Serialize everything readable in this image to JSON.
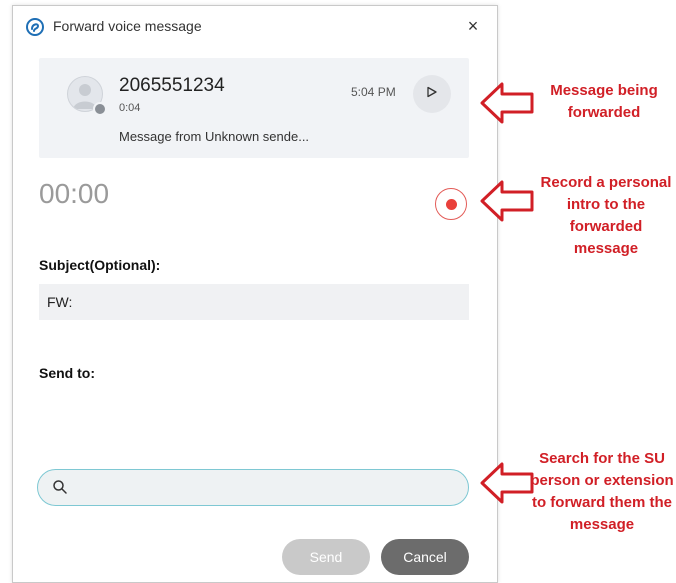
{
  "dialog": {
    "title": "Forward voice message",
    "close_glyph": "×"
  },
  "message": {
    "caller": "2065551234",
    "duration": "0:04",
    "preview": "Message from Unknown sende...",
    "time": "5:04 PM"
  },
  "recorder": {
    "elapsed": "00:00"
  },
  "subject": {
    "label": "Subject(Optional):",
    "value": "FW:"
  },
  "send_to": {
    "label": "Send to:",
    "search_value": "",
    "search_placeholder": ""
  },
  "actions": {
    "send_label": "Send",
    "cancel_label": "Cancel"
  },
  "annotations": {
    "forwarded": "Message being forwarded",
    "record": "Record a personal intro to the forwarded message",
    "search": "Search for the SU person or extension to forward them the message"
  },
  "icons": {
    "app": "app-logo-icon",
    "close": "close-icon",
    "avatar": "person-icon",
    "play": "play-icon",
    "record": "record-icon",
    "search": "search-icon",
    "arrow": "left-arrow-icon"
  },
  "colors": {
    "annotation_red": "#d11f26",
    "record_red": "#e9403b",
    "search_border": "#7ec8d3",
    "send_disabled": "#c9c9c9",
    "cancel": "#6c6c6c"
  }
}
